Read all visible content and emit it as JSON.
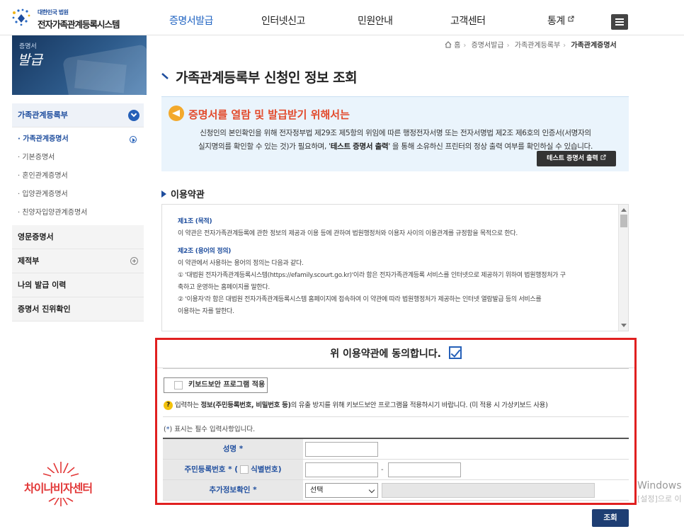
{
  "header": {
    "logo_small": "대한민국 법원",
    "logo_title": "전자가족관계등록시스템",
    "nav": [
      "증명서발급",
      "인터넷신고",
      "민원안내",
      "고객센터",
      "통계"
    ],
    "menu_icon": "hamburger-icon"
  },
  "sidebar": {
    "banner_small": "증명서",
    "banner_title": "발급",
    "groups": [
      {
        "label": "가족관계등록부",
        "open": true
      },
      {
        "label": "영문증명서"
      },
      {
        "label": "제적부"
      },
      {
        "label": "나의 발급 이력"
      },
      {
        "label": "증명서 진위확인"
      }
    ],
    "sub_items": [
      "· 가족관계증명서",
      "· 기본증명서",
      "· 혼인관계증명서",
      "· 입양관계증명서",
      "· 친양자입양관계증명서"
    ]
  },
  "breadcrumb": [
    "홈",
    "증명서발급",
    "가족관계등록부",
    "가족관계증명서"
  ],
  "page_title": "가족관계등록부 신청인 정보 조회",
  "notice": {
    "title": "증명서를 열람 및 발급받기 위해서는",
    "body_1": "신청인의 본인확인을 위해 전자정부법 제29조 제5항의 위임에 따른 행정전자서명 또는 전자서명법 제2조 제6호의 인증서(서명자의",
    "body_2_a": "실지명의를 확인할 수 있는 것)가 필요하며, '",
    "body_2_bold": "테스트 증명서 출력",
    "body_2_b": "' 을 통해 소유하신 프린터의 정상 출력 여부를 확인하실 수 있습니다.",
    "button": "테스트 증명서 출력"
  },
  "terms": {
    "heading": "이용약관",
    "article1_title": "제1조 (목적)",
    "article1_body": "이 약관은 전자가족관계등록에 관한 정보의 제공과 이용 등에 관하여 법원행정처와 이용자 사이의 이용관계를 규정함을 목적으로 한다.",
    "article2_title": "제2조 (용어의 정의)",
    "article2_intro": "이 약관에서 사용하는 용어의 정의는 다음과 같다.",
    "article2_item1a": "① '대법원 전자가족관계등록시스템(https://efamily.scourt.go.kr)'이라 함은 전자가족관계등록 서비스를 인터넷으로 제공하기 위하여 법원행정처가 구",
    "article2_item1b": "축하고 운영하는 홈페이지를 말한다.",
    "article2_item2a": "② '이용자'라 함은 대법원 전자가족관계등록시스템 홈페이지에 접속하여 이 약관에 따라 법원행정처가 제공하는 인터넷 열람발급 등의 서비스를",
    "article2_item2b": "이용하는 자를 말한다."
  },
  "consent": {
    "agree_text": "위 이용약관에 동의합니다.",
    "agree_checked": true,
    "keyboard_button": "키보드보안 프로그램 적용",
    "keyboard_note_a": "입력하는 ",
    "keyboard_note_bold": "정보(주민등록번호, 비밀번호 등)",
    "keyboard_note_b": "의 유출 방지를 위해 키보드보안 프로그램을 적용하시기 바랍니다. (미 적용 시 가상키보드 사용)",
    "required_prefix": "(",
    "required_mark": "*",
    "required_suffix": ") 표시는 필수 입력사항입니다."
  },
  "form": {
    "name_label": "성명",
    "rrn_label": "주민등록번호",
    "rrn_paren_open": "(",
    "rrn_option": "식별번호)",
    "extra_label": "추가정보확인",
    "required_mark": "*",
    "dash": "-",
    "select_value": "선택",
    "name_value": "",
    "rrn_front_value": "",
    "rrn_back_value": ""
  },
  "search_button": "조회",
  "footer_logo": "차이나비자센터",
  "watermark": {
    "line1": "Windows",
    "line2": "[설정]으로 이"
  },
  "colors": {
    "accent": "#1f4e9e",
    "highlight_frame": "#e02020",
    "notice_title": "#e24a2b",
    "notice_bg": "#eaf4fc"
  }
}
